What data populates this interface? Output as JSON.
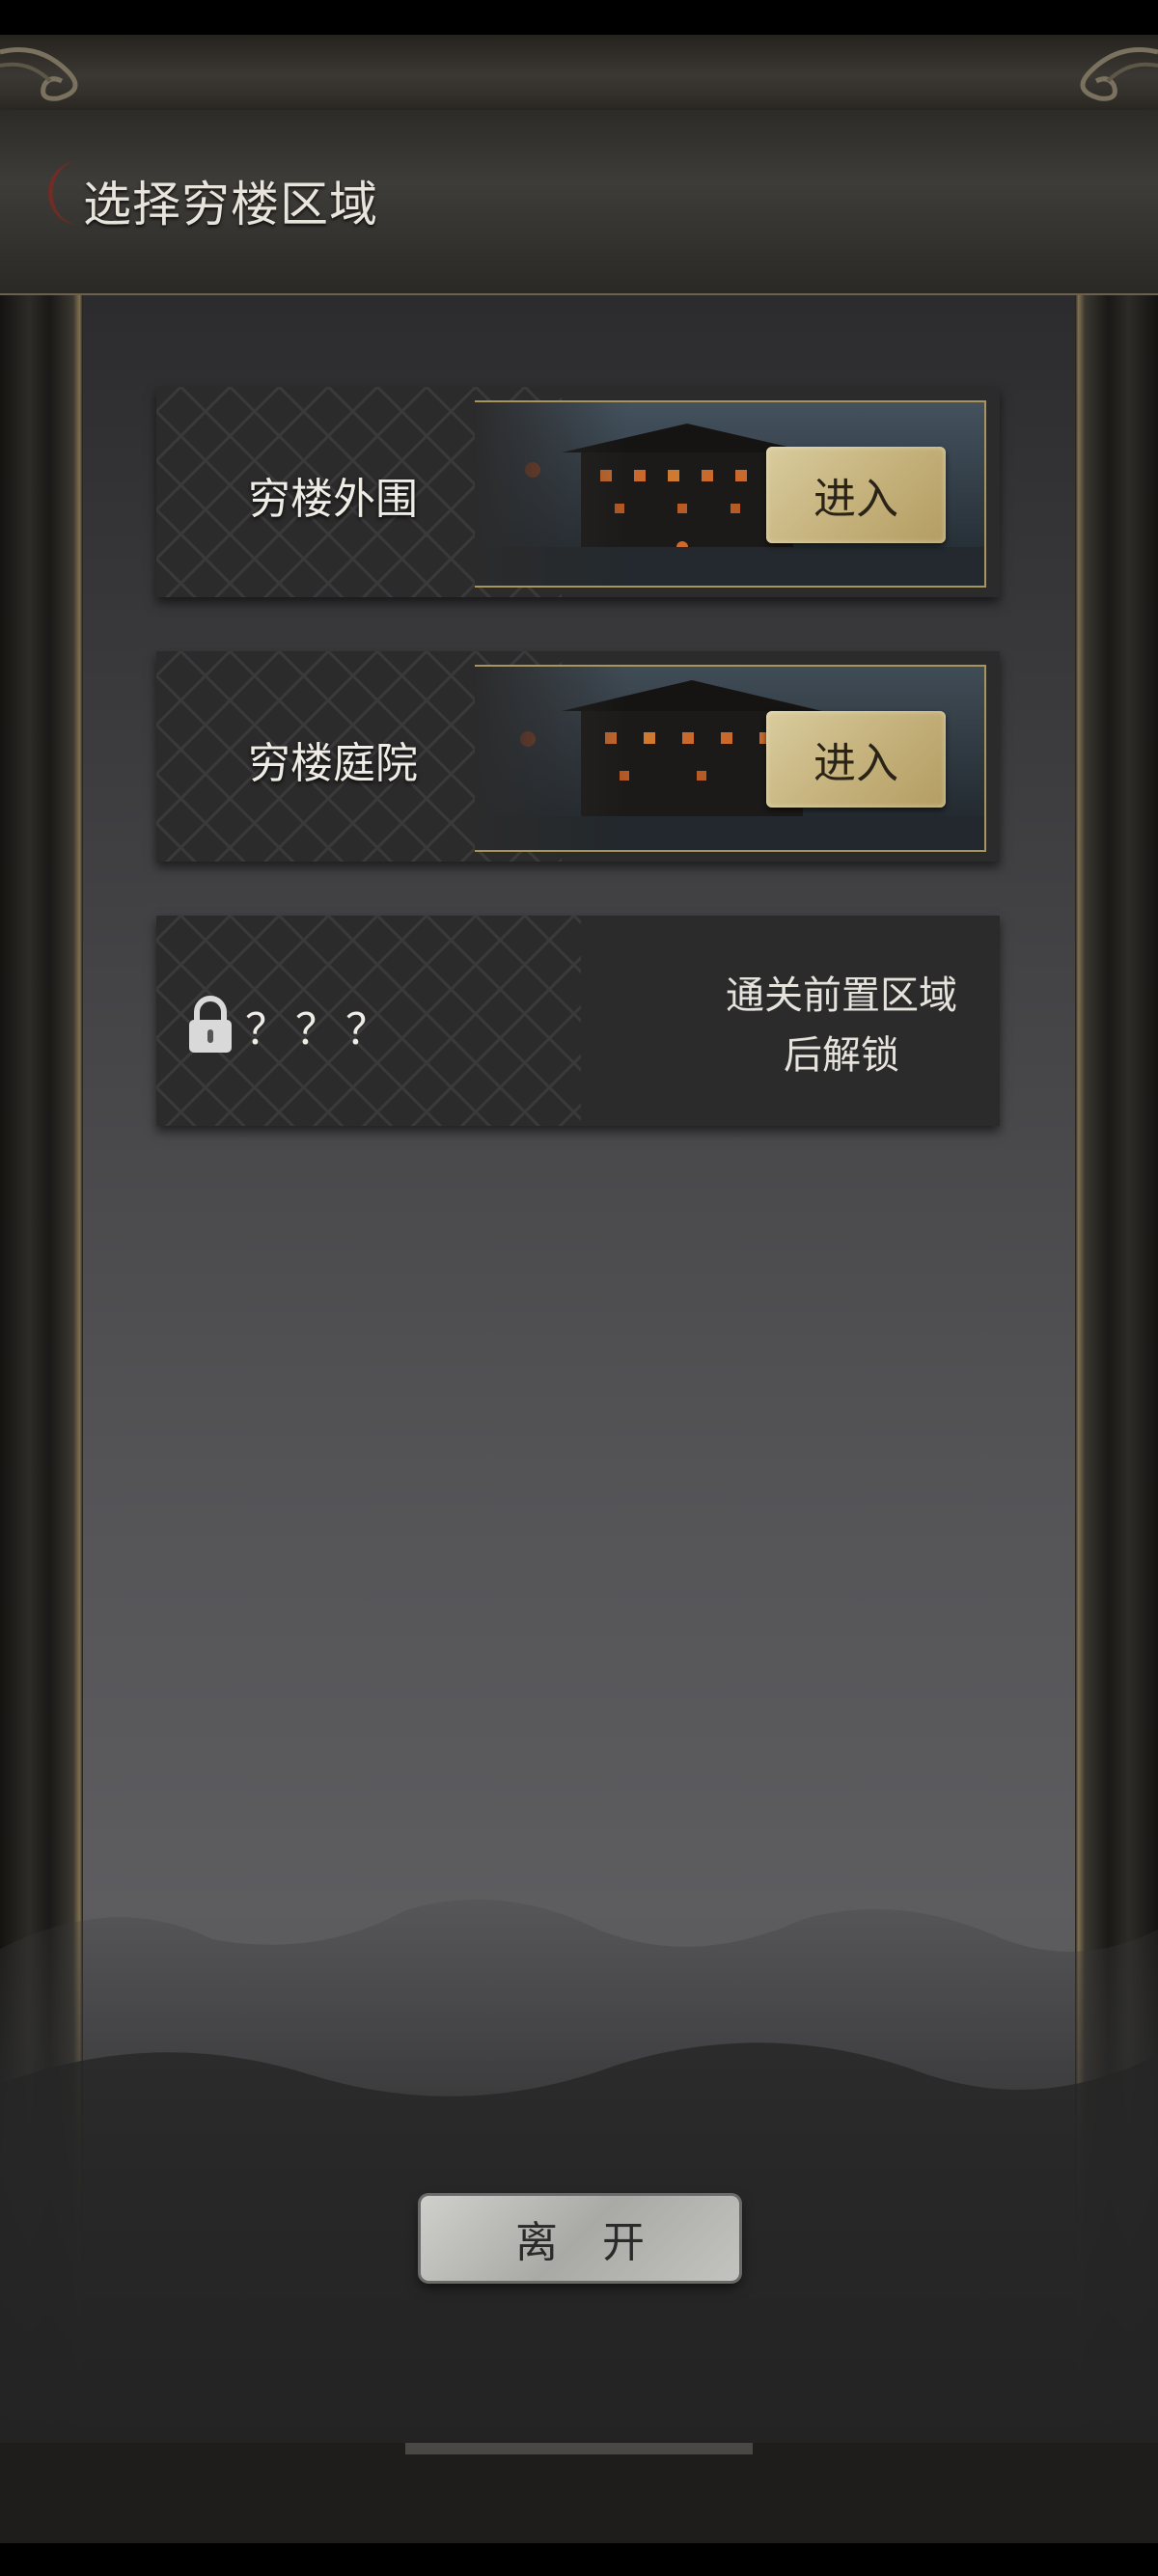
{
  "header": {
    "title": "选择穷楼区域"
  },
  "regions": [
    {
      "name": "穷楼外围",
      "enter_label": "进入",
      "locked": false
    },
    {
      "name": "穷楼庭院",
      "enter_label": "进入",
      "locked": false
    },
    {
      "name": "？？？",
      "locked": true,
      "unlock_hint_line1": "通关前置区域",
      "unlock_hint_line2": "后解锁"
    }
  ],
  "footer": {
    "leave_label": "离开"
  },
  "icons": {
    "header_logo": "crescent-moon-icon",
    "lock": "padlock-icon"
  },
  "colors": {
    "accent_gold": "#c4b07a",
    "panel_gray": "#545457",
    "frame_gold_line": "#a8955e"
  }
}
